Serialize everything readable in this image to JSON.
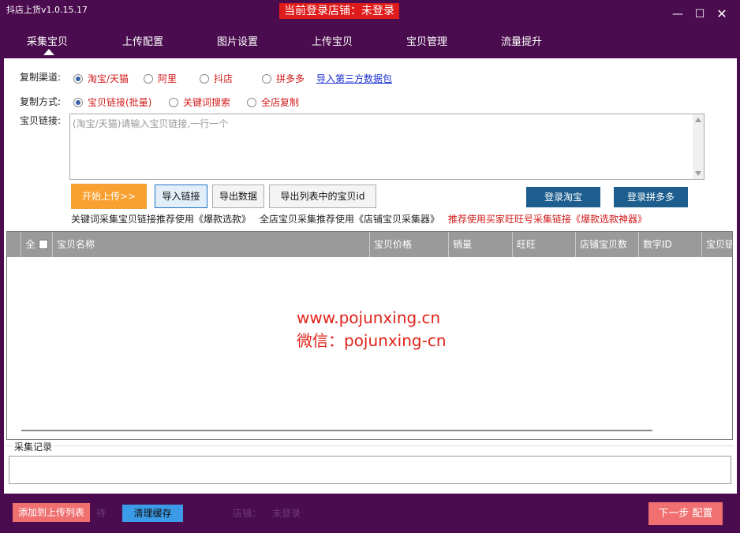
{
  "window": {
    "title": "抖店上货v1.0.15.17",
    "login_status": "当前登录店铺：未登录",
    "minimize": "—",
    "maximize": "☐",
    "close": "✕"
  },
  "menu": {
    "items": [
      "采集宝贝",
      "上传配置",
      "图片设置",
      "上传宝贝",
      "宝贝管理",
      "流量提升"
    ]
  },
  "channel": {
    "label": "复制渠道:",
    "options": [
      "淘宝/天猫",
      "阿里",
      "抖店",
      "拼多多"
    ],
    "selected": 0,
    "import_link": "导入第三方数据包"
  },
  "method": {
    "label": "复制方式:",
    "options": [
      "宝贝链接(批量)",
      "关键词搜索",
      "全店复制"
    ],
    "selected": 0
  },
  "links": {
    "label": "宝贝链接:",
    "placeholder": "(淘宝/天猫)请输入宝贝链接,一行一个"
  },
  "buttons": {
    "start_upload": "开始上传>>",
    "import_links": "导入链接",
    "export_data": "导出数据",
    "export_ids": "导出列表中的宝贝id",
    "login_taobao": "登录淘宝",
    "login_pdd": "登录拼多多"
  },
  "tips": {
    "keyword": "关键词采集宝贝链接推荐使用《爆款选款》",
    "shop": "全店宝贝采集推荐使用《店铺宝贝采集器》",
    "buyer": "推荐使用买家旺旺号采集链接《爆款选款神器》"
  },
  "table": {
    "select_all": "全",
    "columns": [
      "宝贝名称",
      "宝贝价格",
      "销量",
      "旺旺",
      "店铺宝贝数",
      "数字ID",
      "宝贝链"
    ]
  },
  "watermark": {
    "line1": "www.pojunxing.cn",
    "line2": "微信：pojunxing-cn"
  },
  "log": {
    "title": "采集记录"
  },
  "footer": {
    "add_to_upload": "添加到上传列表",
    "clear_cache": "清理缓存",
    "faded_left": "待",
    "faded_shop": "店铺：",
    "faded_status": "未登录",
    "next_step": "下一步  配置"
  },
  "colors": {
    "frame": "#4a0c4e",
    "login_red": "#e01b1b",
    "accent_orange": "#f8a030",
    "navy_button": "#1d5e8f",
    "header_gray": "#9a9a9a",
    "footer_red": "#f07070",
    "footer_blue": "#3b9be8"
  }
}
